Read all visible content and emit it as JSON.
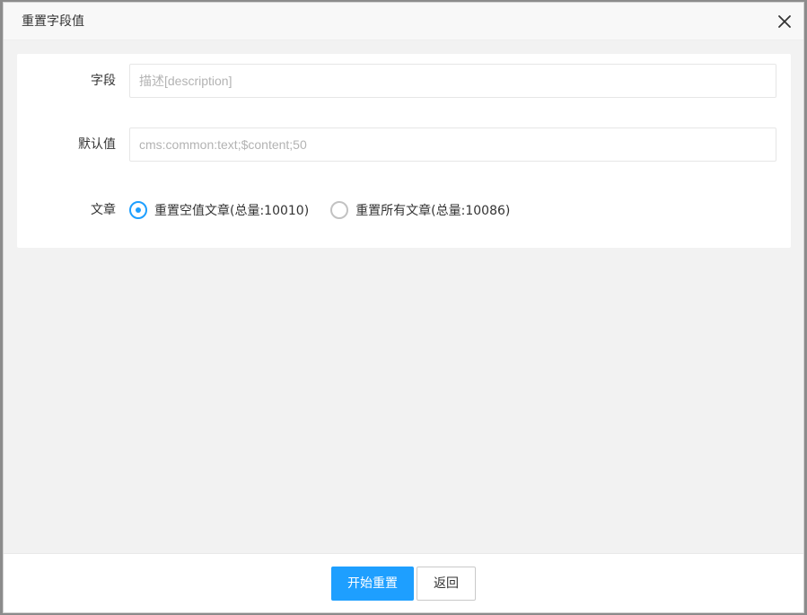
{
  "dialog": {
    "title": "重置字段值"
  },
  "form": {
    "field": {
      "label": "字段",
      "placeholder": "描述[description]",
      "value": ""
    },
    "default_value": {
      "label": "默认值",
      "placeholder": "cms:common:text;$content;50",
      "value": ""
    },
    "articles": {
      "label": "文章",
      "options": [
        {
          "label": "重置空值文章(总量:10010)",
          "checked": true
        },
        {
          "label": "重置所有文章(总量:10086)",
          "checked": false
        }
      ]
    }
  },
  "footer": {
    "start_label": "开始重置",
    "back_label": "返回"
  },
  "colors": {
    "primary": "#1e9fff"
  },
  "icons": {
    "close": "close-icon"
  }
}
